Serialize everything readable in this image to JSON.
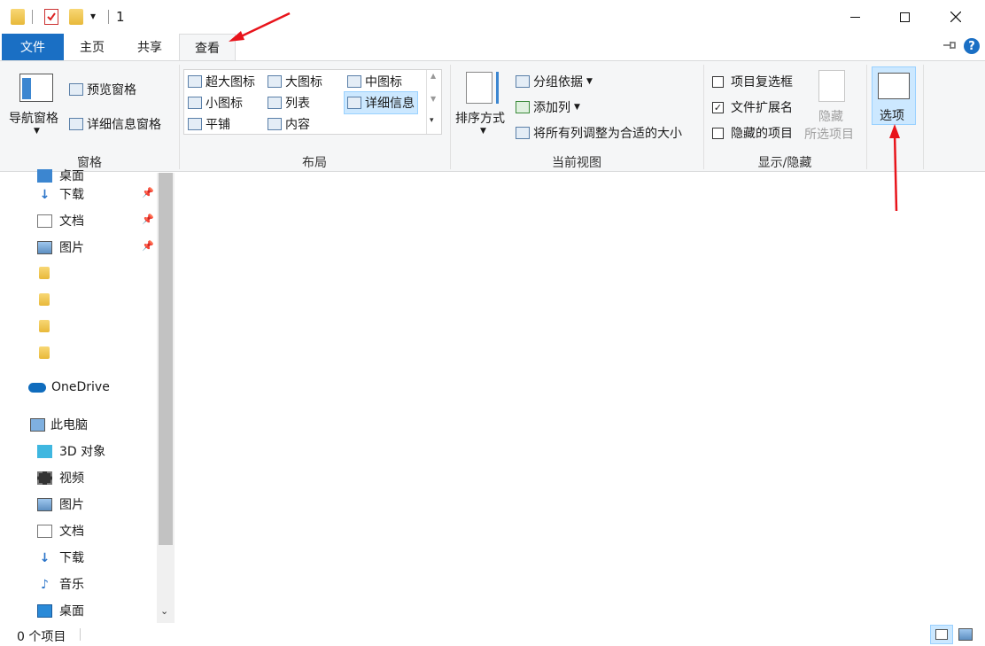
{
  "titlebar": {
    "title": "1",
    "qat_dropdown": "▾",
    "minimize": "—",
    "maximize": "☐",
    "close": "✕"
  },
  "tabs": {
    "file": "文件",
    "home": "主页",
    "share": "共享",
    "view": "查看",
    "pin": "⊣",
    "help": "?"
  },
  "ribbon": {
    "panes": {
      "label": "窗格",
      "nav_pane": "导航窗格",
      "preview_pane": "预览窗格",
      "details_pane": "详细信息窗格"
    },
    "layout": {
      "label": "布局",
      "extra_large": "超大图标",
      "large": "大图标",
      "medium": "中图标",
      "small": "小图标",
      "list": "列表",
      "details": "详细信息",
      "tiles": "平铺",
      "content": "内容"
    },
    "current_view": {
      "label": "当前视图",
      "sort_by": "排序方式",
      "group_by": "分组依据",
      "add_columns": "添加列",
      "fit_columns": "将所有列调整为合适的大小"
    },
    "show_hide": {
      "label": "显示/隐藏",
      "item_checkboxes": "项目复选框",
      "item_checkboxes_checked": false,
      "file_extensions": "文件扩展名",
      "file_extensions_checked": true,
      "hidden_items": "隐藏的项目",
      "hidden_items_checked": false,
      "hide_selected_1": "隐藏",
      "hide_selected_2": "所选项目"
    },
    "options": "选项"
  },
  "nav": {
    "partial_top": "桌面",
    "quick_access": [
      {
        "label": "下载",
        "icon": "download-icon"
      },
      {
        "label": "文档",
        "icon": "document-icon"
      },
      {
        "label": "图片",
        "icon": "pictures-icon"
      }
    ],
    "onedrive": "OneDrive",
    "this_pc": "此电脑",
    "pc_items": [
      {
        "label": "3D 对象",
        "icon": "3d-objects-icon"
      },
      {
        "label": "视频",
        "icon": "video-icon"
      },
      {
        "label": "图片",
        "icon": "pictures-icon"
      },
      {
        "label": "文档",
        "icon": "document-icon"
      },
      {
        "label": "下载",
        "icon": "download-icon"
      },
      {
        "label": "音乐",
        "icon": "music-icon"
      },
      {
        "label": "桌面",
        "icon": "desktop-icon"
      }
    ]
  },
  "status": {
    "item_count": "0 个项目"
  },
  "colors": {
    "file_tab": "#1a6fc4",
    "annotation_arrow": "#e8141b"
  }
}
